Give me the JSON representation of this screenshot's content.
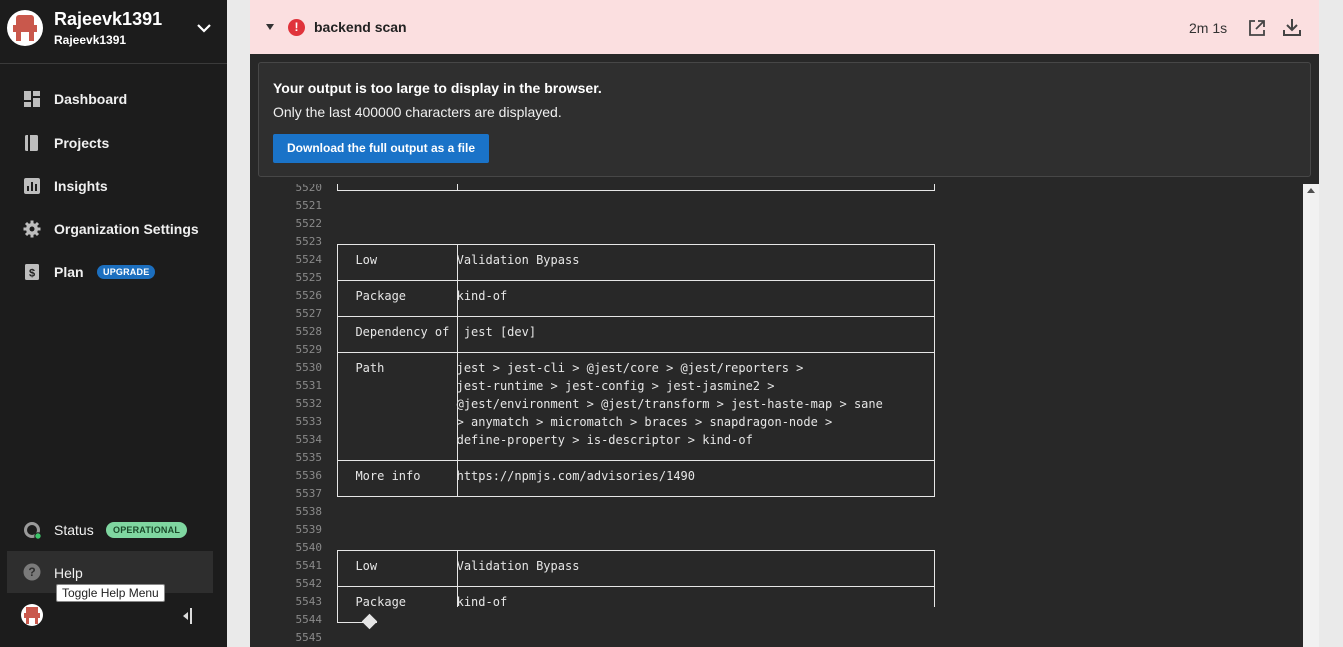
{
  "org": {
    "name": "Rajeevk1391",
    "subname": "Rajeevk1391"
  },
  "nav": [
    {
      "label": "Dashboard",
      "icon": "dashboard-icon"
    },
    {
      "label": "Projects",
      "icon": "book-icon"
    },
    {
      "label": "Insights",
      "icon": "chart-icon"
    },
    {
      "label": "Organization Settings",
      "icon": "gear-icon"
    },
    {
      "label": "Plan",
      "icon": "dollar-icon",
      "badge": "UPGRADE"
    }
  ],
  "status": {
    "label": "Status",
    "badge": "OPERATIONAL"
  },
  "help": {
    "label": "Help",
    "tooltip": "Toggle Help Menu"
  },
  "job": {
    "title": "backend scan",
    "duration": "2m 1s"
  },
  "notice": {
    "title": "Your output is too large to display in the browser.",
    "body": "Only the last 400000 characters are displayed.",
    "button": "Download the full output as a file"
  },
  "log": [
    {
      "n": "5520",
      "t": ""
    },
    {
      "n": "5521",
      "t": ""
    },
    {
      "n": "5522",
      "t": ""
    },
    {
      "n": "5523",
      "t": ""
    },
    {
      "n": "5524",
      "t": "  Low           Validation Bypass"
    },
    {
      "n": "5525",
      "t": ""
    },
    {
      "n": "5526",
      "t": "  Package       kind-of"
    },
    {
      "n": "5527",
      "t": ""
    },
    {
      "n": "5528",
      "t": "  Dependency of  jest [dev]"
    },
    {
      "n": "5529",
      "t": ""
    },
    {
      "n": "5530",
      "t": "  Path          jest > jest-cli > @jest/core > @jest/reporters >"
    },
    {
      "n": "5531",
      "t": "                jest-runtime > jest-config > jest-jasmine2 >"
    },
    {
      "n": "5532",
      "t": "                @jest/environment > @jest/transform > jest-haste-map > sane"
    },
    {
      "n": "5533",
      "t": "                > anymatch > micromatch > braces > snapdragon-node >"
    },
    {
      "n": "5534",
      "t": "                define-property > is-descriptor > kind-of"
    },
    {
      "n": "5535",
      "t": ""
    },
    {
      "n": "5536",
      "t": "  More info     https://npmjs.com/advisories/1490"
    },
    {
      "n": "5537",
      "t": ""
    },
    {
      "n": "5538",
      "t": ""
    },
    {
      "n": "5539",
      "t": ""
    },
    {
      "n": "5540",
      "t": ""
    },
    {
      "n": "5541",
      "t": "  Low           Validation Bypass"
    },
    {
      "n": "5542",
      "t": ""
    },
    {
      "n": "5543",
      "t": "  Package       kind-of"
    },
    {
      "n": "5544",
      "t": ""
    },
    {
      "n": "5545",
      "t": ""
    }
  ],
  "colors": {
    "sidebar": "#1c1c1c",
    "error_header": "#fbdfe0",
    "error_icon": "#e0333b",
    "button": "#1a73c8",
    "log_bg": "#282828"
  }
}
